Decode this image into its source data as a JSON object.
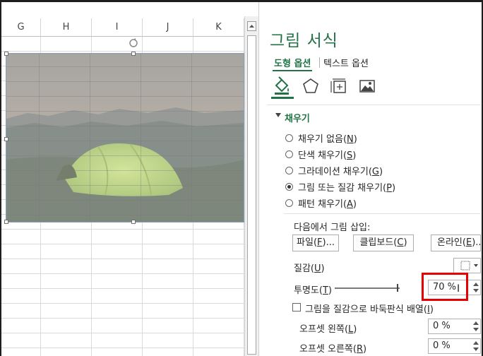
{
  "spreadsheet": {
    "columns": [
      "G",
      "H",
      "I",
      "J",
      "K"
    ],
    "picture_colors": {
      "sky": "#9a9488",
      "sunset": "#c9a58a",
      "mountains": "#6f7370",
      "ground": "#5d6a5a",
      "tent": "#b7d96a"
    }
  },
  "pane": {
    "title": "그림 서식",
    "tabs": {
      "shape_options": "도형 옵션",
      "text_options": "텍스트 옵션"
    },
    "icons": [
      "fill-line-icon",
      "effects-pentagon-icon",
      "size-properties-icon",
      "picture-icon"
    ],
    "fill_section": {
      "header": "채우기",
      "options": [
        {
          "label": "채우기 없음",
          "key": "N",
          "checked": false
        },
        {
          "label": "단색 채우기",
          "key": "S",
          "checked": false
        },
        {
          "label": "그라데이션 채우기",
          "key": "G",
          "checked": false
        },
        {
          "label": "그림 또는 질감 채우기",
          "key": "P",
          "checked": true
        },
        {
          "label": "패턴 채우기",
          "key": "A",
          "checked": false
        }
      ],
      "insert_from": "다음에서 그림 삽입:",
      "buttons": {
        "file": "파일",
        "file_key": "F",
        "clipboard": "클립보드",
        "clipboard_key": "C",
        "online": "온라인",
        "online_key": "E"
      },
      "texture_label": "질감",
      "texture_key": "U",
      "transparency_label": "투명도",
      "transparency_key": "T",
      "transparency_value": "70 %",
      "transparency_percent": 70,
      "tile_label": "그림을 질감으로 바둑판식 배열",
      "tile_key": "I",
      "tile_checked": false,
      "offset_left_label": "오프셋 왼쪽",
      "offset_left_key": "L",
      "offset_left_value": "0 %",
      "offset_right_label": "오프셋 오른쪽",
      "offset_right_key": "R",
      "offset_right_value": "0 %"
    },
    "accent_color": "#217346",
    "highlight_color": "#e60000"
  }
}
